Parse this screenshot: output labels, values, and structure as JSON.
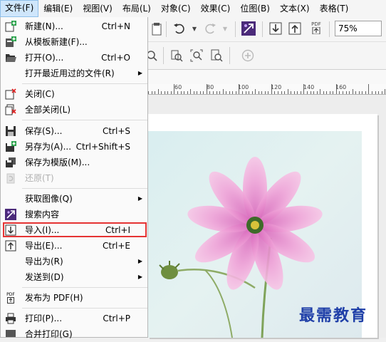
{
  "menubar": {
    "items": [
      "文件(F)",
      "编辑(E)",
      "视图(V)",
      "布局(L)",
      "对象(C)",
      "效果(C)",
      "位图(B)",
      "文本(X)",
      "表格(T)"
    ]
  },
  "toolbar": {
    "zoom_value": "75%",
    "pdf_label": "PDF"
  },
  "ruler": {
    "labels": [
      "60",
      "80",
      "100",
      "120",
      "140",
      "160"
    ]
  },
  "file_menu": {
    "items": [
      {
        "label": "新建(N)...",
        "shortcut": "Ctrl+N"
      },
      {
        "label": "从模板新建(F)...",
        "shortcut": ""
      },
      {
        "label": "打开(O)...",
        "shortcut": "Ctrl+O"
      },
      {
        "label": "打开最近用过的文件(R)",
        "shortcut": ""
      },
      {
        "label": "关闭(C)",
        "shortcut": ""
      },
      {
        "label": "全部关闭(L)",
        "shortcut": ""
      },
      {
        "label": "保存(S)...",
        "shortcut": "Ctrl+S"
      },
      {
        "label": "另存为(A)...",
        "shortcut": "Ctrl+Shift+S"
      },
      {
        "label": "保存为模版(M)...",
        "shortcut": ""
      },
      {
        "label": "还原(T)",
        "shortcut": ""
      },
      {
        "label": "获取图像(Q)",
        "shortcut": ""
      },
      {
        "label": "搜索内容",
        "shortcut": ""
      },
      {
        "label": "导入(I)...",
        "shortcut": "Ctrl+I"
      },
      {
        "label": "导出(E)...",
        "shortcut": "Ctrl+E"
      },
      {
        "label": "导出为(R)",
        "shortcut": ""
      },
      {
        "label": "发送到(D)",
        "shortcut": ""
      },
      {
        "label": "发布为 PDF(H)",
        "shortcut": ""
      },
      {
        "label": "打印(P)...",
        "shortcut": "Ctrl+P"
      },
      {
        "label": "合并打印(G)",
        "shortcut": ""
      }
    ]
  },
  "watermark": {
    "text": "最需教育"
  },
  "colors": {
    "highlight": "#e53333",
    "menu_active": "#cfe6fb",
    "watermark": "#1f3fa8"
  }
}
